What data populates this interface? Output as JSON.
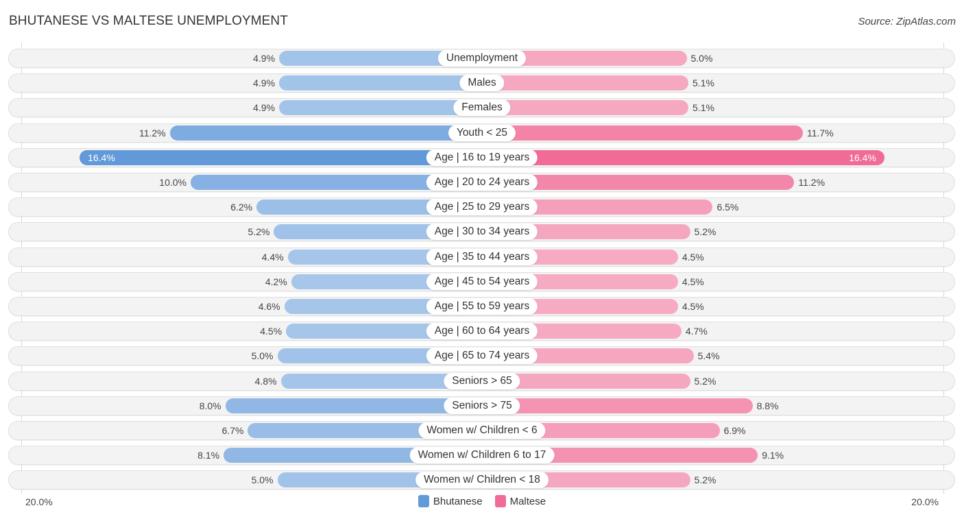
{
  "chart_data": {
    "type": "bar",
    "orientation": "horizontal-diverging",
    "title": "BHUTANESE VS MALTESE UNEMPLOYMENT",
    "source": "Source: ZipAtlas.com",
    "xlim": [
      0,
      20
    ],
    "axis_min_label": "20.0%",
    "axis_max_label": "20.0%",
    "categories": [
      "Unemployment",
      "Males",
      "Females",
      "Youth < 25",
      "Age | 16 to 19 years",
      "Age | 20 to 24 years",
      "Age | 25 to 29 years",
      "Age | 30 to 34 years",
      "Age | 35 to 44 years",
      "Age | 45 to 54 years",
      "Age | 55 to 59 years",
      "Age | 60 to 64 years",
      "Age | 65 to 74 years",
      "Seniors > 65",
      "Seniors > 75",
      "Women w/ Children < 6",
      "Women w/ Children 6 to 17",
      "Women w/ Children < 18"
    ],
    "series": [
      {
        "name": "Bhutanese",
        "color": "#6199d9",
        "values": [
          4.9,
          4.9,
          4.9,
          11.2,
          16.4,
          10.0,
          6.2,
          5.2,
          4.4,
          4.2,
          4.6,
          4.5,
          5.0,
          4.8,
          8.0,
          6.7,
          8.1,
          5.0
        ]
      },
      {
        "name": "Maltese",
        "color": "#f06b95",
        "values": [
          5.0,
          5.1,
          5.1,
          11.7,
          16.4,
          11.2,
          6.5,
          5.2,
          4.5,
          4.5,
          4.5,
          4.7,
          5.4,
          5.2,
          8.8,
          6.9,
          9.1,
          5.2
        ]
      }
    ],
    "legend": {
      "position": "bottom-center",
      "entries": [
        "Bhutanese",
        "Maltese"
      ]
    },
    "value_suffix": "%"
  }
}
